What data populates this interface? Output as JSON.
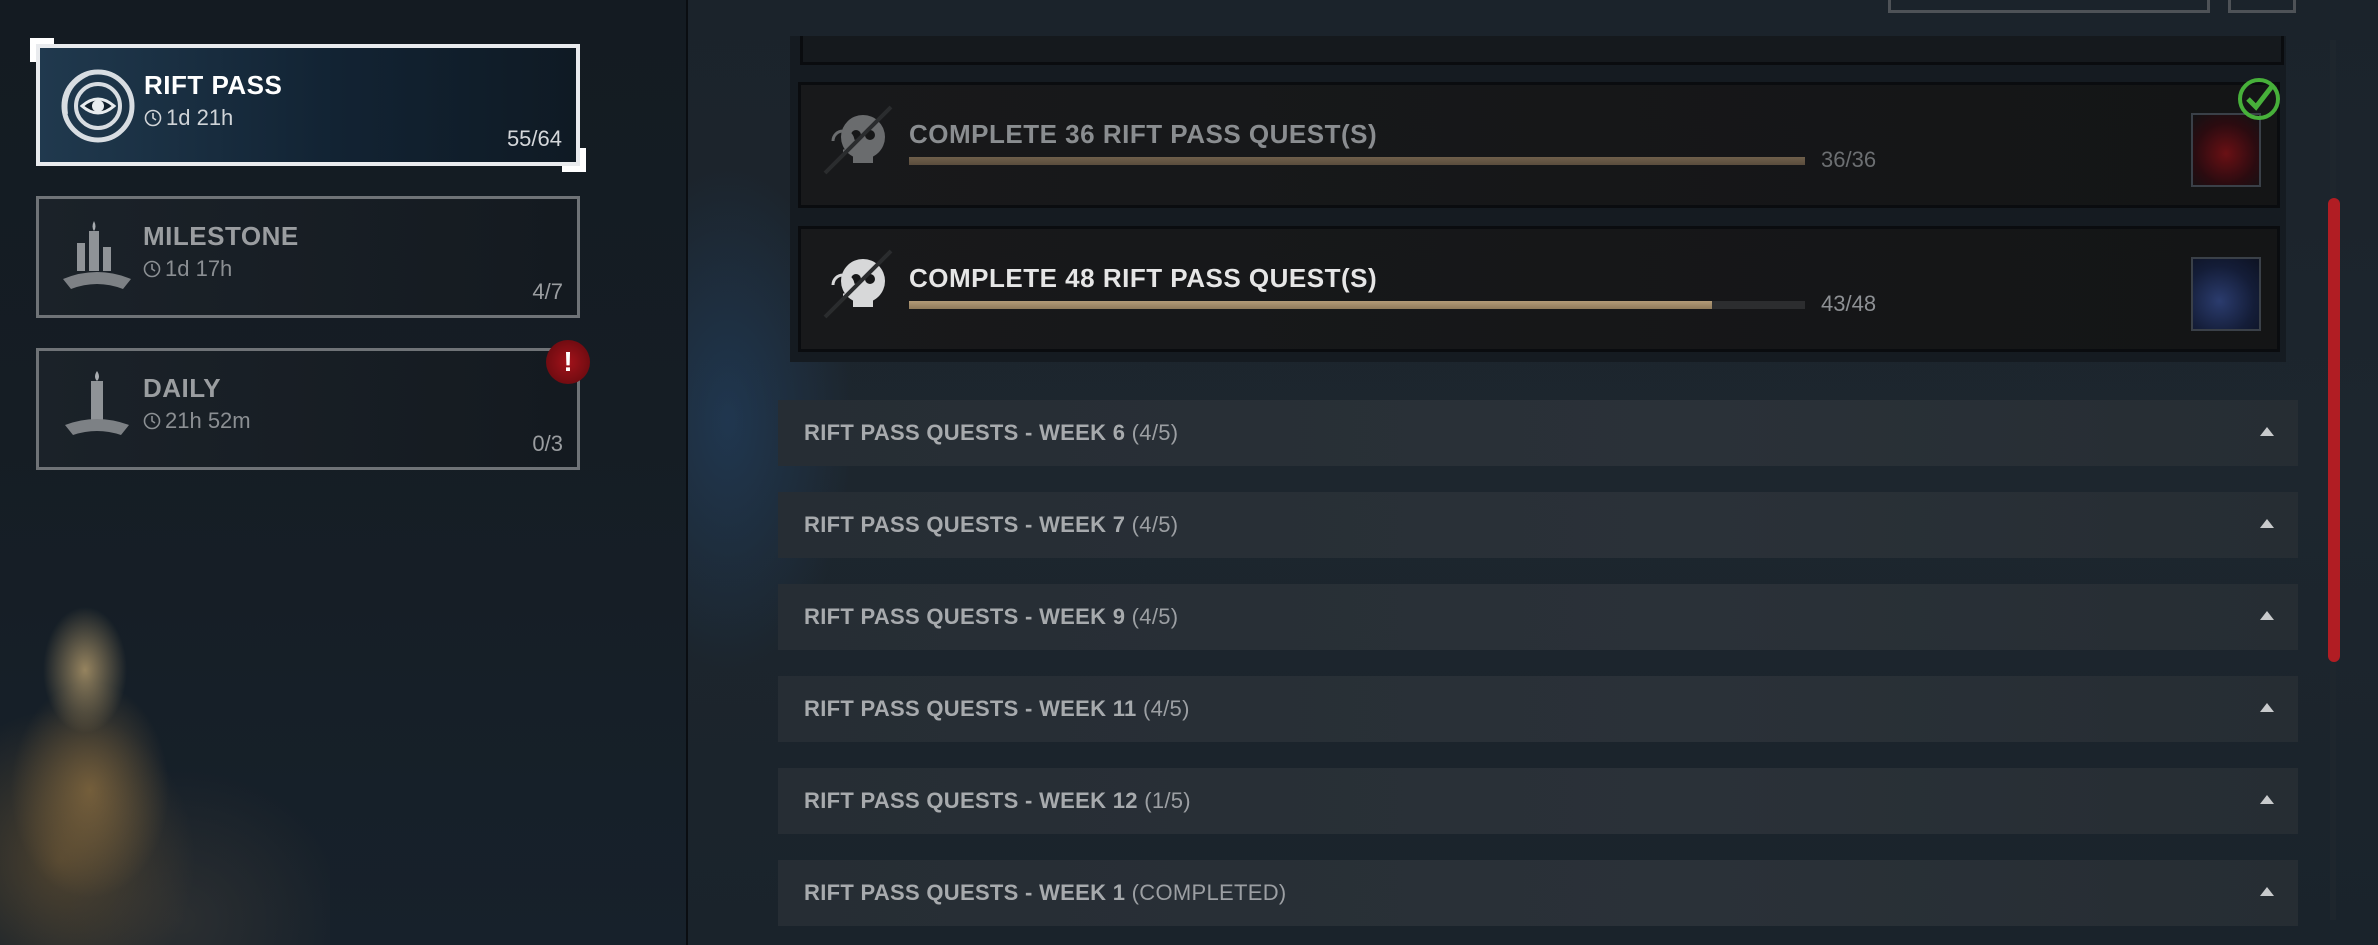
{
  "categories": [
    {
      "title": "RIFT PASS",
      "timer": "1d 21h",
      "count": "55/64",
      "active": true,
      "icon": "spiral-eye-icon"
    },
    {
      "title": "MILESTONE",
      "timer": "1d 17h",
      "count": "4/7",
      "active": false,
      "icon": "candle-altar-icon"
    },
    {
      "title": "DAILY",
      "timer": "21h 52m",
      "count": "0/3",
      "active": false,
      "icon": "candle-dish-icon",
      "alert": "!"
    }
  ],
  "quests": [
    {
      "title": "COMPLETE 36 RIFT PASS QUEST(S)",
      "progress_text": "36/36",
      "progress": 1.0,
      "completed": true,
      "icon": "skull-spiral-icon"
    },
    {
      "title": "COMPLETE 48 RIFT PASS QUEST(S)",
      "progress_text": "43/48",
      "progress": 0.896,
      "completed": false,
      "icon": "skull-spiral-icon"
    }
  ],
  "sections": [
    {
      "title": "RIFT PASS QUESTS - WEEK 6",
      "count": "(4/5)"
    },
    {
      "title": "RIFT PASS QUESTS - WEEK 7",
      "count": "(4/5)"
    },
    {
      "title": "RIFT PASS QUESTS - WEEK 9",
      "count": "(4/5)"
    },
    {
      "title": "RIFT PASS QUESTS - WEEK 11",
      "count": "(4/5)"
    },
    {
      "title": "RIFT PASS QUESTS - WEEK 12",
      "count": "(1/5)"
    },
    {
      "title": "RIFT PASS QUESTS - WEEK 1",
      "count": "(COMPLETED)"
    }
  ],
  "colors": {
    "accent_red": "#b11d23",
    "check_green": "#47b03a",
    "progress_tan": "#b39b78"
  }
}
